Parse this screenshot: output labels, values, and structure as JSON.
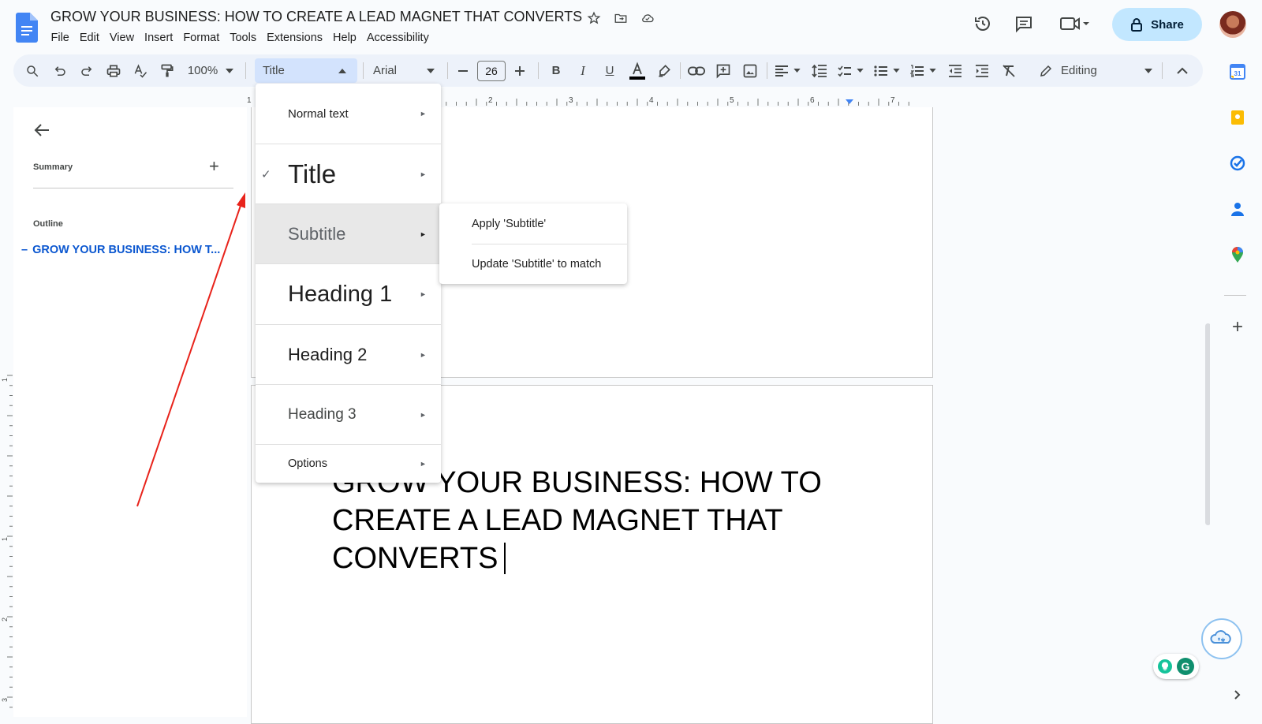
{
  "header": {
    "doc_title": "GROW YOUR BUSINESS: HOW TO CREATE A LEAD MAGNET THAT CONVERTS",
    "menu": [
      "File",
      "Edit",
      "View",
      "Insert",
      "Format",
      "Tools",
      "Extensions",
      "Help",
      "Accessibility"
    ],
    "share_label": "Share"
  },
  "toolbar": {
    "zoom": "100%",
    "style": "Title",
    "font": "Arial",
    "font_size": "26",
    "mode": "Editing"
  },
  "outline_panel": {
    "summary_label": "Summary",
    "outline_label": "Outline",
    "outline_entry": "GROW YOUR BUSINESS: HOW T..."
  },
  "ruler": {
    "h_numbers": [
      "1",
      "1",
      "2",
      "3",
      "4",
      "5",
      "6",
      "7"
    ],
    "v_numbers": [
      "1",
      "1",
      "2",
      "3"
    ]
  },
  "style_menu": {
    "items": [
      {
        "label": "Normal text",
        "checked": false
      },
      {
        "label": "Title",
        "checked": true
      },
      {
        "label": "Subtitle",
        "checked": false
      },
      {
        "label": "Heading 1",
        "checked": false
      },
      {
        "label": "Heading 2",
        "checked": false
      },
      {
        "label": "Heading 3",
        "checked": false
      },
      {
        "label": "Options",
        "checked": false
      }
    ],
    "check_glyph": "✓",
    "arrow_glyph": "►"
  },
  "submenu": {
    "apply": "Apply 'Subtitle'",
    "update": "Update 'Subtitle' to match"
  },
  "document": {
    "heading": "GROW YOUR BUSINESS: HOW TO CREATE A LEAD MAGNET THAT CONVERTS"
  },
  "colors": {
    "accent": "#0b57d0",
    "share_bg": "#c2e7ff",
    "toolbar_bg": "#edf2fa",
    "annotation": "#e8231b"
  }
}
